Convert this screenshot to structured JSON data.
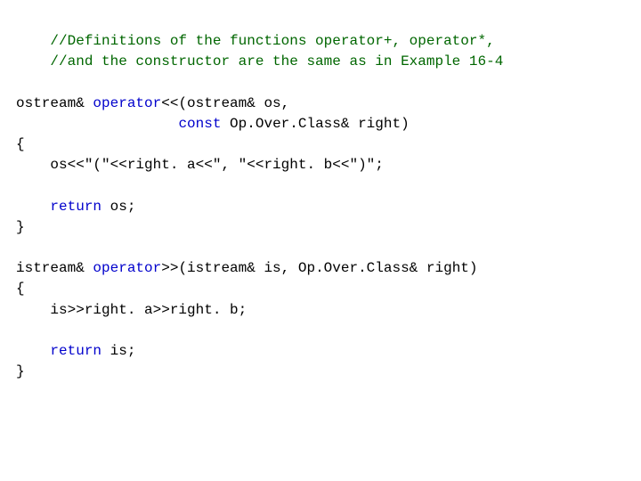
{
  "comment1": "    //Definitions of the functions operator+, operator*,",
  "comment2": "    //and the constructor are the same as in Example 16-4",
  "blank": "",
  "l01a": "ostream& ",
  "l01b": "operator",
  "l01c": "<<(ostream& os,",
  "l02a": "                   ",
  "l02b": "const",
  "l02c": " Op.Over.Class& right)",
  "l03": "{",
  "l04": "    os<<\"(\"<<right. a<<\", \"<<right. b<<\")\";",
  "l05a": "    ",
  "l05b": "return",
  "l05c": " os;",
  "l06": "}",
  "l07a": "istream& ",
  "l07b": "operator",
  "l07c": ">>(istream& is, Op.Over.Class& right)",
  "l08": "{",
  "l09": "    is>>right. a>>right. b;",
  "l10a": "    ",
  "l10b": "return",
  "l10c": " is;",
  "l11": "}"
}
